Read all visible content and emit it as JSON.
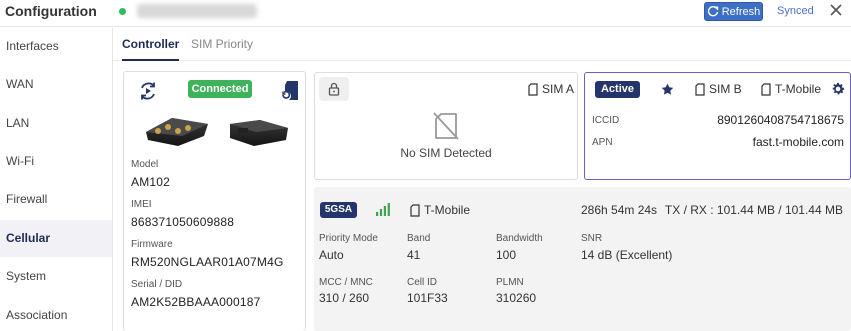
{
  "header": {
    "title": "Configuration",
    "refresh_label": "Refresh",
    "synced_label": "Synced",
    "status_color": "#2ebd5a",
    "accent_color": "#3d6fc4"
  },
  "sidebar": {
    "items": [
      {
        "label": "Interfaces"
      },
      {
        "label": "WAN"
      },
      {
        "label": "LAN"
      },
      {
        "label": "Wi-Fi"
      },
      {
        "label": "Firewall"
      },
      {
        "label": "Cellular"
      },
      {
        "label": "System"
      },
      {
        "label": "Association"
      }
    ],
    "active": "Cellular"
  },
  "tabs": [
    {
      "label": "Controller"
    },
    {
      "label": "SIM Priority"
    }
  ],
  "device": {
    "status": "Connected",
    "status_color": "#3fb35c",
    "model_label": "Model",
    "model": "AM102",
    "imei_label": "IMEI",
    "imei": "868371050609888",
    "firmware_label": "Firmware",
    "firmware": "RM520NGLAAR01A07M4G",
    "serial_label": "Serial / DID",
    "serial": "AM2K52BBAAA000187"
  },
  "sim_a": {
    "label": "SIM A",
    "status": "No SIM Detected"
  },
  "sim_b": {
    "status": "Active",
    "label": "SIM B",
    "carrier": "T-Mobile",
    "iccid_label": "ICCID",
    "iccid": "8901260408754718675",
    "apn_label": "APN",
    "apn": "fast.t-mobile.com"
  },
  "connection": {
    "technology": "5GSA",
    "carrier": "T-Mobile",
    "uptime": "286h 54m 24s",
    "traffic": "TX / RX : 101.44 MB / 101.44 MB",
    "priority_mode_label": "Priority Mode",
    "priority_mode": "Auto",
    "band_label": "Band",
    "band": "41",
    "bandwidth_label": "Bandwidth",
    "bandwidth": "100",
    "snr_label": "SNR",
    "snr": "14 dB (Excellent)",
    "mcc_mnc_label": "MCC / MNC",
    "mcc_mnc": "310 / 260",
    "cell_id_label": "Cell ID",
    "cell_id": "101F33",
    "plmn_label": "PLMN",
    "plmn": "310260",
    "signal_color": "#3fa34d"
  }
}
